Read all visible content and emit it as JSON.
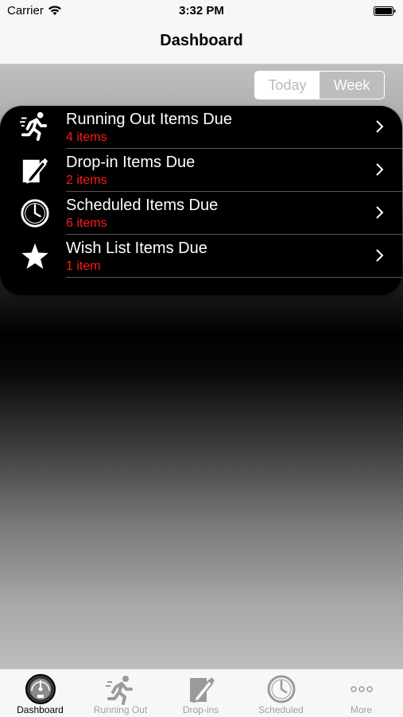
{
  "status_bar": {
    "carrier": "Carrier",
    "time": "3:32 PM"
  },
  "nav": {
    "title": "Dashboard"
  },
  "segmented": {
    "options": [
      "Today",
      "Week"
    ],
    "selected": "Week"
  },
  "rows": [
    {
      "title": "Running Out Items Due",
      "count": "4 items",
      "icon": "running-man-icon"
    },
    {
      "title": "Drop-in Items Due",
      "count": "2 items",
      "icon": "note-pencil-icon"
    },
    {
      "title": "Scheduled Items Due",
      "count": "6 items",
      "icon": "clock-icon"
    },
    {
      "title": "Wish List Items Due",
      "count": "1 item",
      "icon": "star-icon"
    }
  ],
  "tabs": [
    {
      "label": "Dashboard",
      "icon": "dashboard-gauge-icon",
      "active": true
    },
    {
      "label": "Running Out",
      "icon": "running-man-icon",
      "active": false
    },
    {
      "label": "Drop-ins",
      "icon": "note-pencil-icon",
      "active": false
    },
    {
      "label": "Scheduled",
      "icon": "clock-icon",
      "active": false
    },
    {
      "label": "More",
      "icon": "more-dots-icon",
      "active": false
    }
  ],
  "colors": {
    "count_text": "#ff1a1a",
    "card_background": "#000000",
    "selected_segment": "#bdbdbd"
  }
}
